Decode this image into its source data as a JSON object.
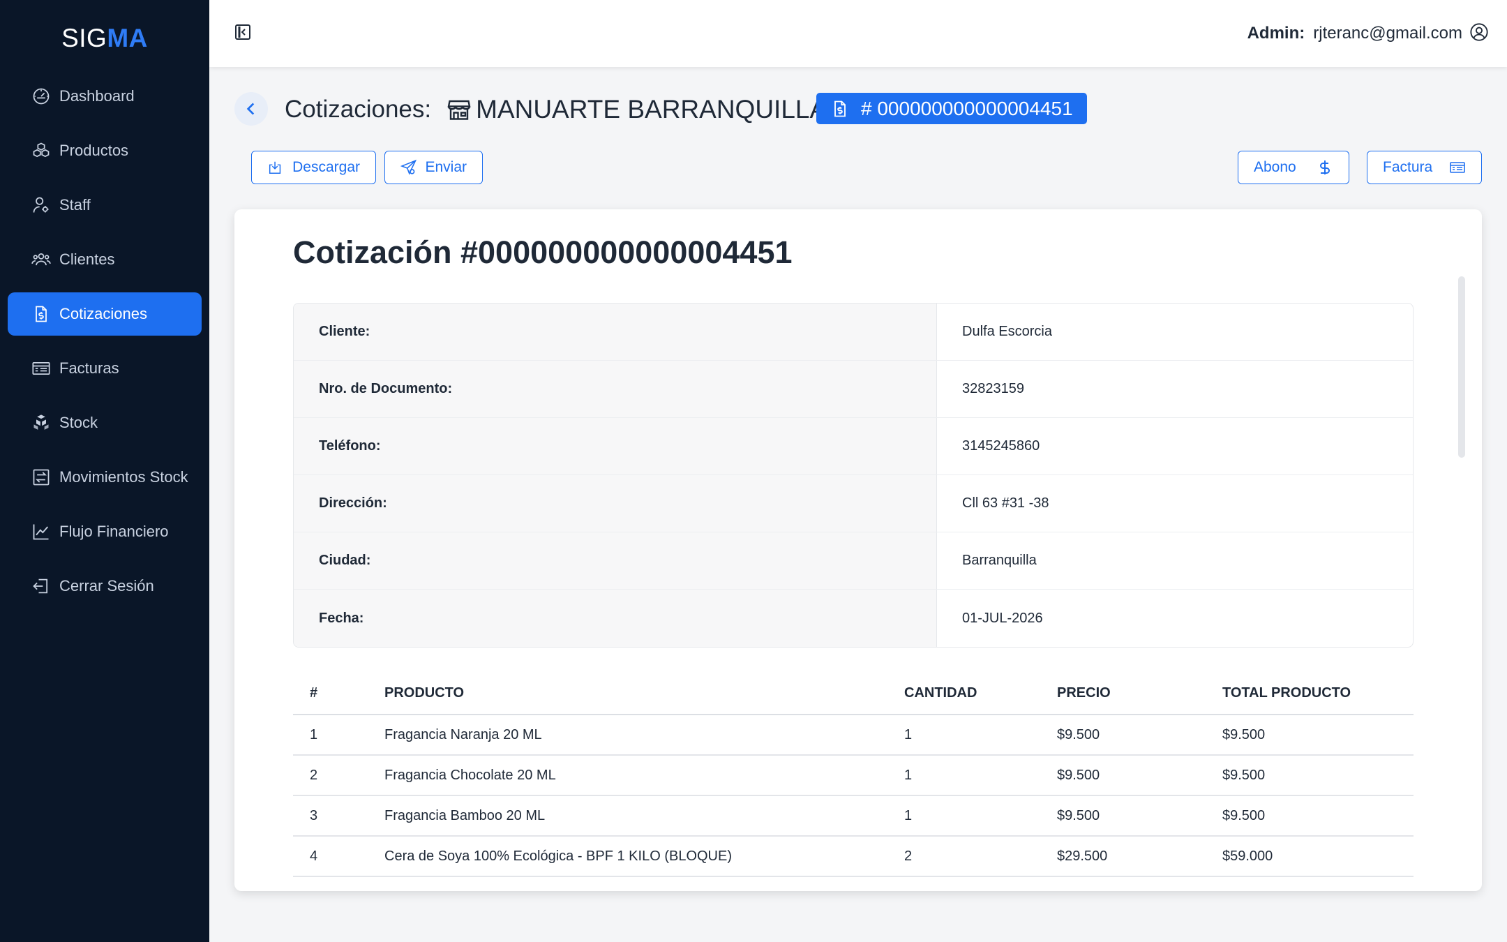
{
  "brand": {
    "part1": "SIG",
    "part2": "MA"
  },
  "sidebar": {
    "items": [
      {
        "label": "Dashboard",
        "icon": "dashboard-icon"
      },
      {
        "label": "Productos",
        "icon": "boxes-icon"
      },
      {
        "label": "Staff",
        "icon": "user-gear-icon"
      },
      {
        "label": "Clientes",
        "icon": "users-icon"
      },
      {
        "label": "Cotizaciones",
        "icon": "file-dollar-icon",
        "active": true
      },
      {
        "label": "Facturas",
        "icon": "invoice-icon"
      },
      {
        "label": "Stock",
        "icon": "stock-boxes-icon"
      },
      {
        "label": "Movimientos Stock",
        "icon": "transfer-icon"
      },
      {
        "label": "Flujo Financiero",
        "icon": "line-chart-icon"
      },
      {
        "label": "Cerrar Sesión",
        "icon": "logout-icon"
      }
    ]
  },
  "header": {
    "admin_label": "Admin:",
    "admin_email": "rjteranc@gmail.com"
  },
  "page": {
    "title": "Cotizaciones:",
    "store_name": "MANUARTE BARRANQUILLA",
    "quote_number": "# 000000000000004451"
  },
  "actions": {
    "download": "Descargar",
    "send": "Enviar",
    "payment": "Abono",
    "invoice": "Factura"
  },
  "quote": {
    "title": "Cotización #000000000000004451",
    "info": [
      {
        "label": "Cliente:",
        "value": "Dulfa Escorcia"
      },
      {
        "label": "Nro. de Documento:",
        "value": "32823159"
      },
      {
        "label": "Teléfono:",
        "value": "3145245860"
      },
      {
        "label": "Dirección:",
        "value": "Cll 63 #31 -38"
      },
      {
        "label": "Ciudad:",
        "value": "Barranquilla"
      },
      {
        "label": "Fecha:",
        "value": "01-JUL-2026"
      }
    ],
    "columns": [
      "#",
      "PRODUCTO",
      "CANTIDAD",
      "PRECIO",
      "TOTAL PRODUCTO"
    ],
    "rows": [
      [
        "1",
        "Fragancia Naranja 20 ML",
        "1",
        "$9.500",
        "$9.500"
      ],
      [
        "2",
        "Fragancia Chocolate 20 ML",
        "1",
        "$9.500",
        "$9.500"
      ],
      [
        "3",
        "Fragancia Bamboo 20 ML",
        "1",
        "$9.500",
        "$9.500"
      ],
      [
        "4",
        "Cera de Soya 100% Ecológica - BPF 1 KILO (BLOQUE)",
        "2",
        "$29.500",
        "$59.000"
      ]
    ]
  },
  "colors": {
    "sidebar_bg": "#0a1628",
    "accent": "#1e6ff0",
    "brand_accent": "#2f7cf6"
  }
}
